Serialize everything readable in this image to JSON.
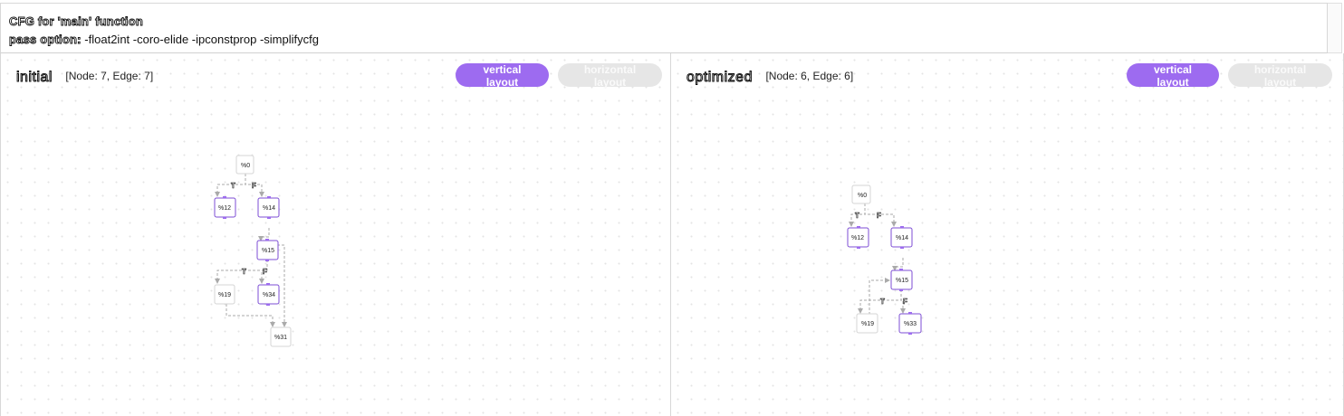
{
  "header": {
    "title": "CFG for 'main' function",
    "pass_label": "pass option:",
    "pass_value": " -float2int -coro-elide -ipconstprop -simplifycfg"
  },
  "panels": [
    {
      "title": "initial",
      "stats": "[Node: 7, Edge: 7]",
      "vertical_btn": "vertical layout",
      "horizontal_btn": "horizontal layout",
      "nodes": [
        "%0",
        "%12",
        "%14",
        "%15",
        "%19",
        "%34",
        "%31"
      ],
      "edge_labels": [
        "T",
        "F",
        "T",
        "F"
      ]
    },
    {
      "title": "optimized",
      "stats": "[Node: 6, Edge: 6]",
      "vertical_btn": "vertical layout",
      "horizontal_btn": "horizontal layout",
      "nodes": [
        "%0",
        "%12",
        "%14",
        "%15",
        "%19",
        "%33"
      ],
      "edge_labels": [
        "T",
        "F",
        "T",
        "F"
      ]
    }
  ],
  "colors": {
    "accent": "#9d6bf0",
    "node_purple_border": "#7d4ed4",
    "edge": "#aaaaaa"
  }
}
